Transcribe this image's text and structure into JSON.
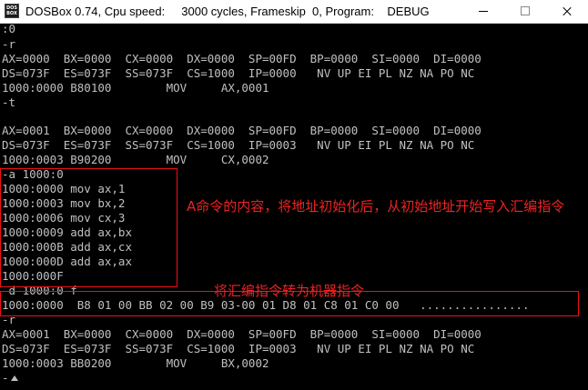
{
  "window": {
    "icon_text": "DOS BOX",
    "title": "DOSBox 0.74, Cpu speed:     3000 cycles, Frameskip  0, Program:    DEBUG"
  },
  "console_lines": [
    ":0",
    "-r",
    "AX=0000  BX=0000  CX=0000  DX=0000  SP=00FD  BP=0000  SI=0000  DI=0000",
    "DS=073F  ES=073F  SS=073F  CS=1000  IP=0000   NV UP EI PL NZ NA PO NC",
    "1000:0000 B80100        MOV     AX,0001",
    "-t",
    "",
    "AX=0001  BX=0000  CX=0000  DX=0000  SP=00FD  BP=0000  SI=0000  DI=0000",
    "DS=073F  ES=073F  SS=073F  CS=1000  IP=0003   NV UP EI PL NZ NA PO NC",
    "1000:0003 B90200        MOV     CX,0002",
    "-a 1000:0",
    "1000:0000 mov ax,1",
    "1000:0003 mov bx,2",
    "1000:0006 mov cx,3",
    "1000:0009 add ax,bx",
    "1000:000B add ax,cx",
    "1000:000D add ax,ax",
    "1000:000F",
    "-d 1000:0 f",
    "1000:0000  B8 01 00 BB 02 00 B9 03-00 01 D8 01 C8 01 C0 00   ................",
    "-r",
    "AX=0001  BX=0000  CX=0000  DX=0000  SP=00FD  BP=0000  SI=0000  DI=0000",
    "DS=073F  ES=073F  SS=073F  CS=1000  IP=0003   NV UP EI PL NZ NA PO NC",
    "1000:0003 BB0200        MOV     BX,0002",
    "-"
  ],
  "annotations": {
    "a_command": "A命令的内容，将地址初始化后，从初始地址开始写入汇编指令",
    "d_command": "将汇编指令转为机器指令"
  },
  "colors": {
    "background": "#000000",
    "text": "#c0c0c0",
    "annotation": "#ee2222"
  }
}
